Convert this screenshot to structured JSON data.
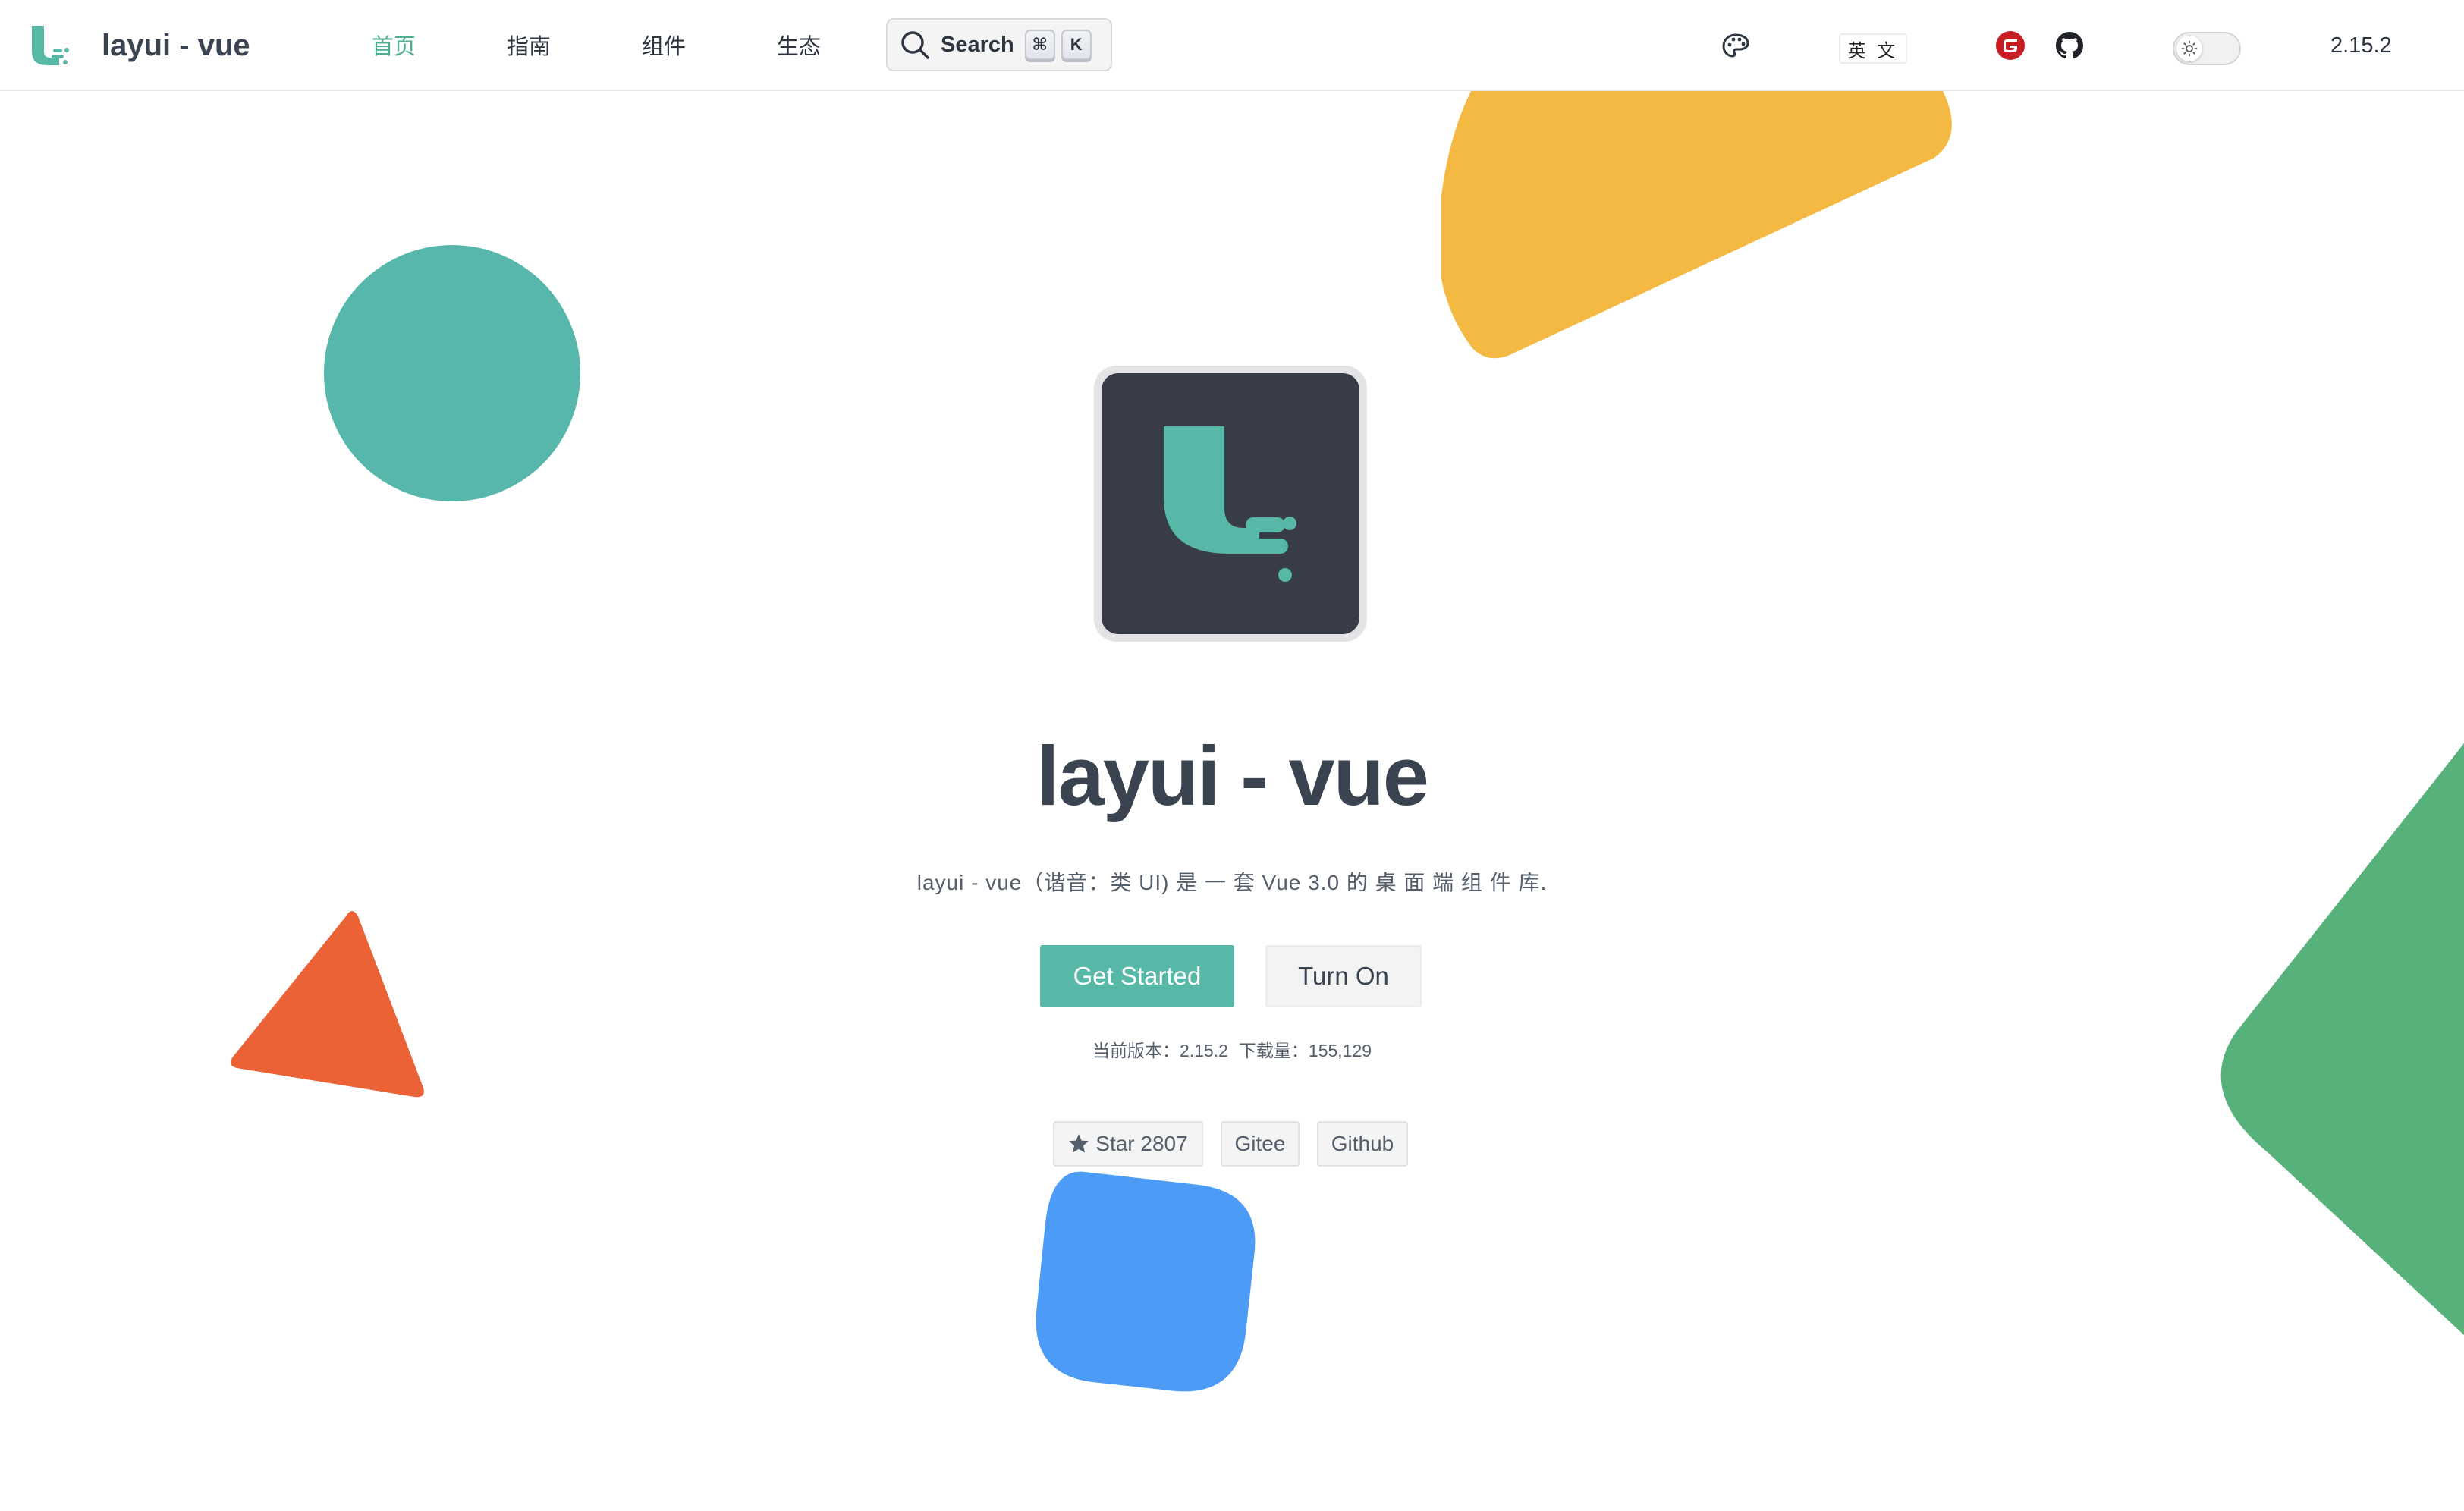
{
  "header": {
    "brand_name": "layui - vue",
    "nav": [
      {
        "label": "首页",
        "active": true
      },
      {
        "label": "指南",
        "active": false
      },
      {
        "label": "组件",
        "active": false
      },
      {
        "label": "生态",
        "active": false
      }
    ],
    "search": {
      "label": "Search",
      "key1": "⌘",
      "key2": "K"
    },
    "language_button": "英 文",
    "version": "2.15.2"
  },
  "hero": {
    "title": "layui - vue",
    "tagline": "layui - vue（谐音：类 UI) 是 一 套 Vue 3.0 的 桌 面 端 组 件 库.",
    "primary_button": "Get Started",
    "secondary_button": "Turn On",
    "stats": {
      "version_text": "当前版本：2.15.2",
      "downloads_text": "下载量：155,129"
    },
    "badges": {
      "star": "Star 2807",
      "gitee": "Gitee",
      "github": "Github"
    }
  },
  "colors": {
    "brand_teal": "#58b8a8",
    "nav_active": "#4fae8c",
    "logo_bg": "#373c47",
    "shape_yellow": "#f4b942",
    "shape_teal": "#57b7aa",
    "shape_orange": "#eb6236",
    "shape_green": "#56b27a",
    "shape_blue": "#4b9bf7",
    "gitee_red": "#c71d23"
  },
  "icons": {
    "brand_logo": "layui-logo-icon",
    "search": "search-icon",
    "theme_palette": "palette-icon",
    "gitee": "gitee-icon",
    "github": "github-icon",
    "toggle": "sun-icon",
    "star": "star-icon"
  }
}
